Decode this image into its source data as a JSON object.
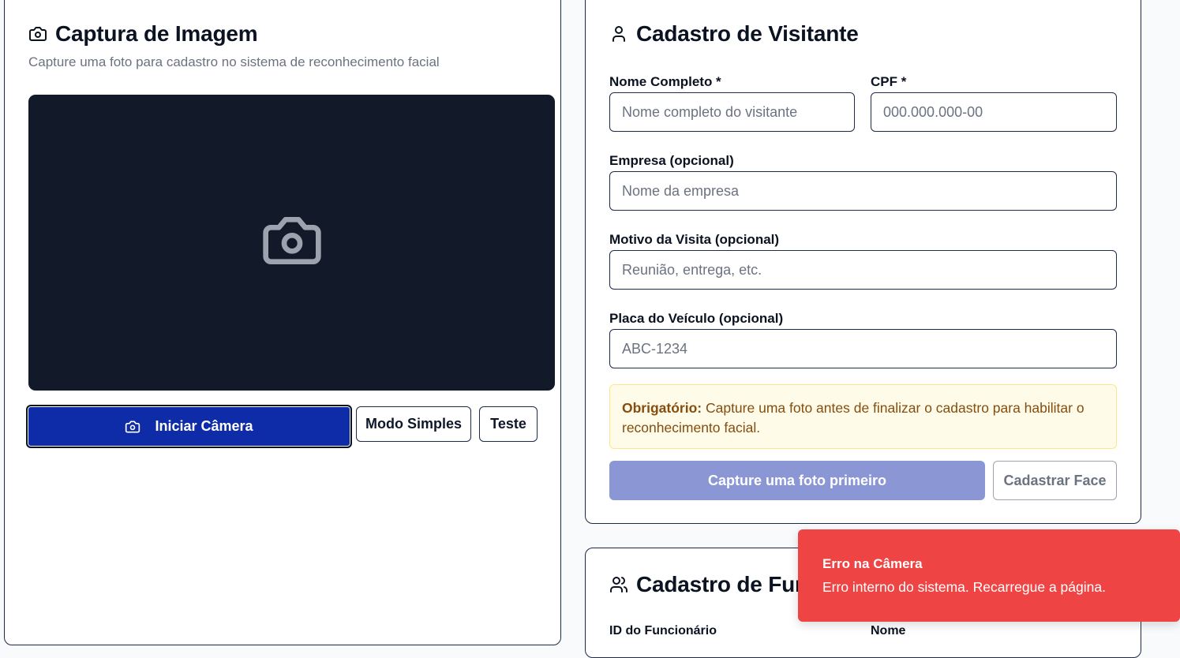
{
  "capture": {
    "title": "Captura de Imagem",
    "subtitle": "Capture uma foto para cadastro no sistema de reconhecimento facial",
    "start_camera_label": "Iniciar Câmera",
    "simple_mode_label": "Modo Simples",
    "test_label": "Teste"
  },
  "visitor": {
    "title": "Cadastro de Visitante",
    "name_label": "Nome Completo *",
    "name_placeholder": "Nome completo do visitante",
    "cpf_label": "CPF *",
    "cpf_placeholder": "000.000.000-00",
    "company_label": "Empresa (opcional)",
    "company_placeholder": "Nome da empresa",
    "reason_label": "Motivo da Visita (opcional)",
    "reason_placeholder": "Reunião, entrega, etc.",
    "plate_label": "Placa do Veículo (opcional)",
    "plate_placeholder": "ABC-1234",
    "notice_strong": "Obrigatório:",
    "notice_text": " Capture uma foto antes de finalizar o cadastro para habilitar o reconhecimento facial.",
    "submit_label": "Capture uma foto primeiro",
    "register_face_label": "Cadastrar Face"
  },
  "employee": {
    "title": "Cadastro de Funcionário",
    "id_label": "ID do Funcionário",
    "name_label": "Nome"
  },
  "toast": {
    "title": "Erro na Câmera",
    "description": "Erro interno do sistema. Recarregue a página."
  },
  "colors": {
    "primary": "#0f2ca8",
    "primary_disabled": "#8a97d4",
    "dark_panel": "#121a2a",
    "error": "#ef4444",
    "notice_bg": "#fefbe8"
  }
}
